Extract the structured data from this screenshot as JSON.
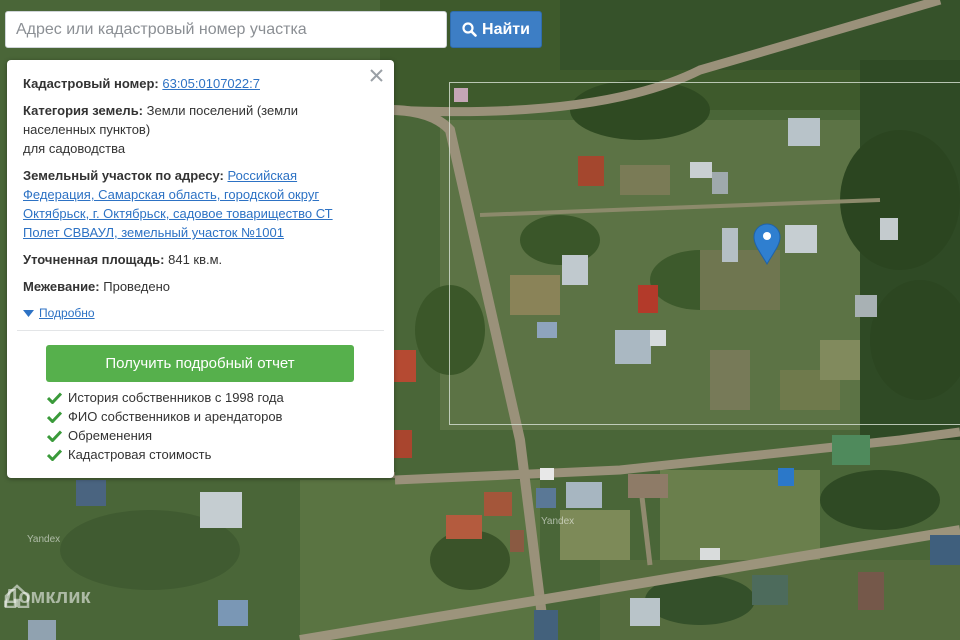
{
  "search": {
    "placeholder": "Адрес или кадастровый номер участка",
    "button_label": "Найти",
    "button_color": "#3d7ec5"
  },
  "info": {
    "cadastral_label": "Кадастровый номер:",
    "cadastral_number": "63:05:0107022:7",
    "category_label": "Категория земель:",
    "category_value_1": "Земли поселений (земли",
    "category_value_2": "населенных пунктов)",
    "category_value_3": "для садоводства",
    "address_label": "Земельный участок по адресу:",
    "address_1": "Российская",
    "address_2": "Федерация, Самарская область, городской округ",
    "address_3": "Октябрьск, г. Октябрьск, садовое товарищество СТ",
    "address_4": "Полет СВВАУЛ, земельный участок №1001",
    "area_label": "Уточненная площадь:",
    "area_value": "841 кв.м.",
    "survey_label": "Межевание:",
    "survey_value": "Проведено",
    "details_label": "Подробно",
    "report_button": "Получить подробный отчет",
    "report_color": "#56b04c",
    "features": [
      "История собственников с 1998 года",
      "ФИО собственников и арендаторов",
      "Обременения",
      "Кадастровая стоимость"
    ]
  },
  "map": {
    "pin_color": "#2f7fd0",
    "watermark": "Домклик",
    "provider_mark": "Yandex"
  }
}
